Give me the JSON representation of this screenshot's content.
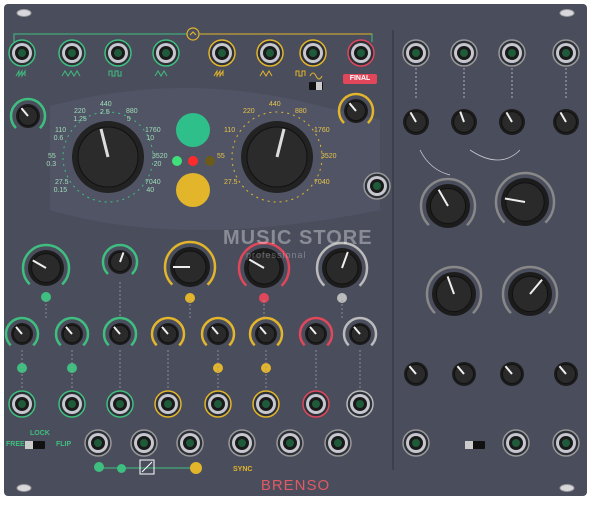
{
  "module": {
    "brand": "BRENSO",
    "final_label": "FINAL",
    "sync_label": "SYNC",
    "lock_label": "LOCK",
    "free_label": "FREE",
    "flip_label": "FLIP",
    "watermark": "MUSIC STORE",
    "watermark_sub": "professional"
  },
  "scales": {
    "left": [
      "440",
      "2.5",
      "880",
      "5",
      "1760",
      "10",
      "3520",
      "20",
      "7040",
      "40",
      "220",
      "1.25",
      "110",
      "0.6",
      "55",
      "0.3",
      "27.5",
      "0.15"
    ],
    "right": [
      "440",
      "880",
      "1760",
      "3520",
      "7040",
      "220",
      "110",
      "55",
      "27.5"
    ]
  },
  "colors": {
    "panel": "#4a4d5c",
    "green": "#3fbf7f",
    "yellow": "#e2b52b",
    "red": "#e0475a",
    "white": "#e8e8ee"
  }
}
